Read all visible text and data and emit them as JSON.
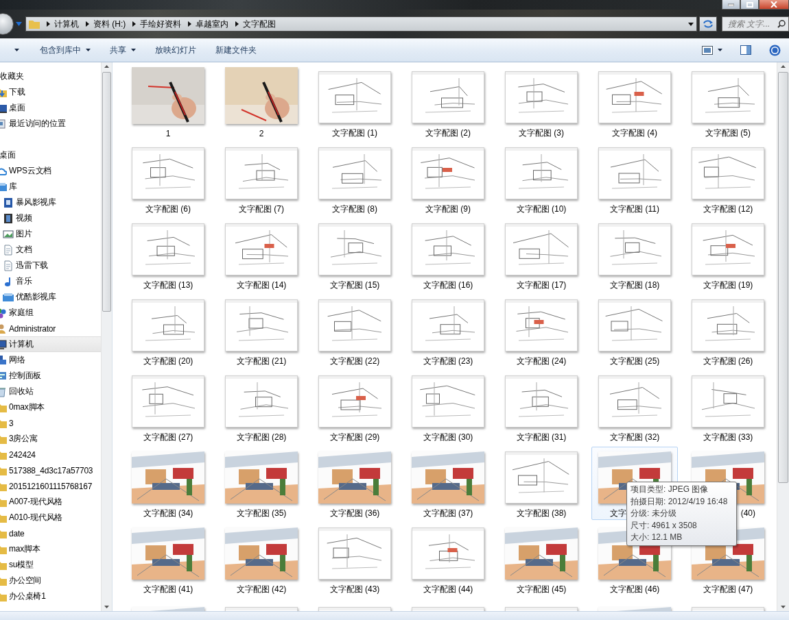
{
  "address_bar": {
    "breadcrumbs": [
      "计算机",
      "资料 (H:)",
      "手绘好资料",
      "卓越室内",
      "文字配图"
    ]
  },
  "search": {
    "placeholder": "搜索 文字..."
  },
  "toolbar": {
    "items": [
      {
        "label": "包含到库中",
        "menu": true
      },
      {
        "label": "共享",
        "menu": true
      },
      {
        "label": "放映幻灯片",
        "menu": false
      },
      {
        "label": "新建文件夹",
        "menu": false
      }
    ]
  },
  "sidebar": {
    "items": [
      {
        "label": "收藏夹",
        "kind": "header",
        "selected": false,
        "children": [
          {
            "label": "下载",
            "kind": "download",
            "selected": false
          },
          {
            "label": "桌面",
            "kind": "desktop",
            "selected": false
          },
          {
            "label": "最近访问的位置",
            "kind": "recent",
            "selected": false
          }
        ]
      },
      {
        "label": "桌面",
        "kind": "header",
        "selected": false,
        "children": [
          {
            "label": "WPS云文档",
            "kind": "cloud",
            "selected": false
          },
          {
            "label": "库",
            "kind": "library",
            "selected": false,
            "children": [
              {
                "label": "暴风影视库",
                "kind": "media",
                "selected": false
              },
              {
                "label": "视频",
                "kind": "video",
                "selected": false
              },
              {
                "label": "图片",
                "selected": false
              },
              {
                "label": "文档",
                "kind": "document",
                "selected": false
              },
              {
                "label": "迅雷下载",
                "kind": "document",
                "selected": false
              },
              {
                "label": "音乐",
                "kind": "music",
                "selected": false
              },
              {
                "label": "优酷影视库",
                "kind": "library",
                "selected": false
              }
            ]
          },
          {
            "label": "家庭组",
            "kind": "homegroup",
            "selected": false
          },
          {
            "label": "Administrator",
            "kind": "user",
            "selected": false
          },
          {
            "label": "计算机",
            "kind": "computer",
            "selected": true
          },
          {
            "label": "网络",
            "kind": "network",
            "selected": false
          },
          {
            "label": "控制面板",
            "kind": "control",
            "selected": false
          },
          {
            "label": "回收站",
            "kind": "recycle",
            "selected": false
          },
          {
            "label": "0max脚本",
            "kind": "folder",
            "selected": false
          },
          {
            "label": "3",
            "kind": "folder",
            "selected": false
          },
          {
            "label": "3房公寓",
            "kind": "folder",
            "selected": false
          },
          {
            "label": "242424",
            "kind": "folder",
            "selected": false
          },
          {
            "label": "517388_4d3c17a57703",
            "kind": "folder",
            "selected": false
          },
          {
            "label": "2015121601115768167",
            "kind": "folder",
            "selected": false
          },
          {
            "label": "A007-现代风格",
            "kind": "folder",
            "selected": false
          },
          {
            "label": "A010-现代风格",
            "kind": "folder",
            "selected": false
          },
          {
            "label": "date",
            "kind": "folder",
            "selected": false
          },
          {
            "label": "max脚本",
            "kind": "folder",
            "selected": false
          },
          {
            "label": "su模型",
            "kind": "folder",
            "selected": false
          },
          {
            "label": "办公空间",
            "kind": "folder",
            "selected": false
          },
          {
            "label": "办公桌椅1",
            "kind": "folder",
            "selected": false
          }
        ]
      }
    ]
  },
  "files": [
    {
      "label": "1",
      "hovered": false
    },
    {
      "label": "2",
      "hovered": false
    },
    {
      "label": "文字配图 (1)",
      "kind": "sketch",
      "hovered": false
    },
    {
      "label": "文字配图 (2)",
      "kind": "sketch",
      "hovered": false
    },
    {
      "label": "文字配图 (3)",
      "kind": "sketch",
      "hovered": false
    },
    {
      "label": "文字配图 (4)",
      "kind": "sketch",
      "hovered": false
    },
    {
      "label": "文字配图 (5)",
      "kind": "sketch",
      "hovered": false
    },
    {
      "label": "文字配图 (6)",
      "kind": "sketch",
      "hovered": false
    },
    {
      "label": "文字配图 (7)",
      "kind": "sketch",
      "hovered": false
    },
    {
      "label": "文字配图 (8)",
      "kind": "sketch",
      "hovered": false
    },
    {
      "label": "文字配图 (9)",
      "kind": "sketch",
      "hovered": false
    },
    {
      "label": "文字配图 (10)",
      "kind": "sketch",
      "hovered": false
    },
    {
      "label": "文字配图 (11)",
      "kind": "sketch",
      "hovered": false
    },
    {
      "label": "文字配图 (12)",
      "kind": "sketch",
      "hovered": false
    },
    {
      "label": "文字配图 (13)",
      "kind": "sketch",
      "hovered": false
    },
    {
      "label": "文字配图 (14)",
      "kind": "sketch",
      "hovered": false
    },
    {
      "label": "文字配图 (15)",
      "kind": "sketch",
      "hovered": false
    },
    {
      "label": "文字配图 (16)",
      "kind": "sketch",
      "hovered": false
    },
    {
      "label": "文字配图 (17)",
      "kind": "sketch",
      "hovered": false
    },
    {
      "label": "文字配图 (18)",
      "kind": "sketch",
      "hovered": false
    },
    {
      "label": "文字配图 (19)",
      "kind": "sketch",
      "hovered": false
    },
    {
      "label": "文字配图 (20)",
      "kind": "sketch",
      "hovered": false
    },
    {
      "label": "文字配图 (21)",
      "kind": "sketch",
      "hovered": false
    },
    {
      "label": "文字配图 (22)",
      "kind": "sketch",
      "hovered": false
    },
    {
      "label": "文字配图 (23)",
      "kind": "sketch",
      "hovered": false
    },
    {
      "label": "文字配图 (24)",
      "kind": "sketch",
      "hovered": false
    },
    {
      "label": "文字配图 (25)",
      "kind": "sketch",
      "hovered": false
    },
    {
      "label": "文字配图 (26)",
      "kind": "sketch",
      "hovered": false
    },
    {
      "label": "文字配图 (27)",
      "kind": "sketch",
      "hovered": false
    },
    {
      "label": "文字配图 (28)",
      "kind": "sketch",
      "hovered": false
    },
    {
      "label": "文字配图 (29)",
      "kind": "sketch",
      "hovered": false
    },
    {
      "label": "文字配图 (30)",
      "kind": "sketch",
      "hovered": false
    },
    {
      "label": "文字配图 (31)",
      "kind": "sketch",
      "hovered": false
    },
    {
      "label": "文字配图 (32)",
      "kind": "sketch",
      "hovered": false
    },
    {
      "label": "文字配图 (33)",
      "kind": "sketch",
      "hovered": false
    },
    {
      "label": "文字配图 (34)",
      "kind": "interior",
      "hovered": false
    },
    {
      "label": "文字配图 (35)",
      "kind": "interior",
      "hovered": false
    },
    {
      "label": "文字配图 (36)",
      "kind": "interior",
      "hovered": false
    },
    {
      "label": "文字配图 (37)",
      "kind": "interior",
      "hovered": false
    },
    {
      "label": "文字配图 (38)",
      "kind": "sketch",
      "hovered": false
    },
    {
      "label": "文字",
      "kind": "interior",
      "hovered": true,
      "cut_end": true
    },
    {
      "label": "(40)",
      "kind": "interior",
      "hovered": false,
      "cut_start": true
    },
    {
      "label": "文字配图 (41)",
      "kind": "interior",
      "hovered": false
    },
    {
      "label": "文字配图 (42)",
      "kind": "interior",
      "hovered": false
    },
    {
      "label": "文字配图 (43)",
      "kind": "sketch",
      "hovered": false
    },
    {
      "label": "文字配图 (44)",
      "kind": "sketch",
      "hovered": false
    },
    {
      "label": "文字配图 (45)",
      "kind": "interior",
      "hovered": false
    },
    {
      "label": "文字配图 (46)",
      "kind": "interior",
      "hovered": false
    },
    {
      "label": "文字配图 (47)",
      "kind": "interior",
      "hovered": false
    },
    {
      "kind": "interior",
      "hovered": false
    },
    {
      "kind": "sketch",
      "hovered": false
    },
    {
      "kind": "sketch",
      "hovered": false
    },
    {
      "kind": "sketch",
      "hovered": false
    },
    {
      "kind": "sketch",
      "hovered": false
    },
    {
      "kind": "interior",
      "hovered": false
    },
    {
      "kind": "sketch",
      "hovered": false
    }
  ],
  "tooltip": {
    "lines": [
      "项目类型: JPEG 图像",
      "拍摄日期: 2012/4/19 16:48",
      "分级: 未分级",
      "尺寸: 4961 x 3508",
      "大小: 12.1 MB"
    ]
  }
}
